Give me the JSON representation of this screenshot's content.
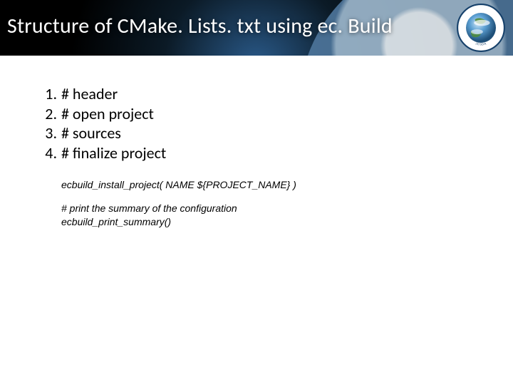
{
  "title": "Structure of CMake. Lists. txt using ec. Build",
  "list": {
    "items": [
      {
        "text": "# header"
      },
      {
        "text": "# open project"
      },
      {
        "text": "# sources"
      },
      {
        "text": "# finalize project"
      }
    ]
  },
  "code": {
    "line1": "ecbuild_install_project( NAME ${PROJECT_NAME} )",
    "line2": "# print the summary of the configuration",
    "line3": "ecbuild_print_summary()"
  },
  "seal": {
    "label": "JCSDA"
  }
}
